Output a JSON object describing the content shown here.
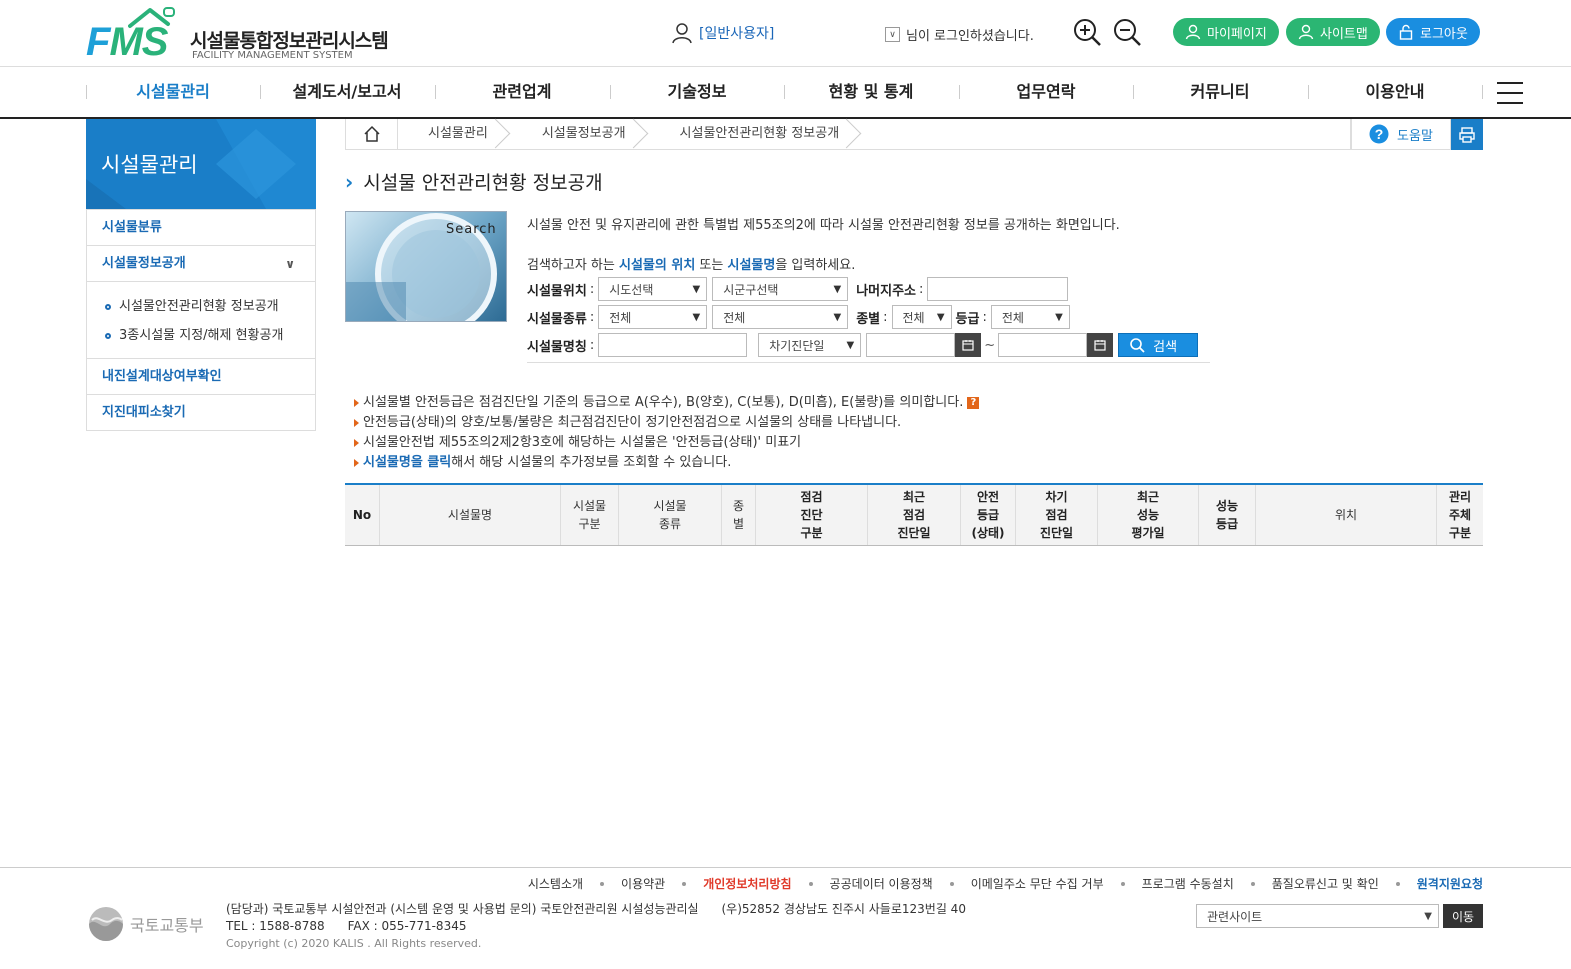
{
  "header": {
    "logo_mark": "FMS",
    "logo_title": "시설물통합정보관리시스템",
    "logo_subtitle": "FACILITY MANAGEMENT SYSTEM",
    "user_name": "[일반사용자]",
    "login_message": "님이 로그인하셨습니다.",
    "mypage_label": "마이페이지",
    "sitemap_label": "사이트맵",
    "logout_label": "로그아웃",
    "colors": {
      "green": "#2bb673",
      "blue": "#1a8ee0"
    }
  },
  "nav": {
    "items": [
      {
        "label": "시설물관리"
      },
      {
        "label": "설계도서/보고서"
      },
      {
        "label": "관련업계"
      },
      {
        "label": "기술정보"
      },
      {
        "label": "현황 및 통계"
      },
      {
        "label": "업무연락"
      },
      {
        "label": "커뮤니티"
      },
      {
        "label": "이용안내"
      }
    ],
    "active_color": "#1a7ec8"
  },
  "sidebar": {
    "title": "시설물관리",
    "items": [
      {
        "label": "시설물분류"
      },
      {
        "label": "시설물정보공개"
      },
      {
        "label": "내진설계대상여부확인"
      },
      {
        "label": "지진대피소찾기"
      }
    ],
    "sub_items": [
      {
        "label": "시설물안전관리현황 정보공개"
      },
      {
        "label": "3종시설물 지정/해제 현황공개"
      }
    ]
  },
  "breadcrumb": {
    "items": [
      "시설물관리",
      "시설물정보공개",
      "시설물안전관리현황 정보공개"
    ],
    "help_label": "도움말"
  },
  "page": {
    "title": "시설물 안전관리현황 정보공개",
    "image_word": "Search",
    "intro": "시설물 안전 및 유지관리에 관한 특별법 제55조의2에 따라 시설물 안전관리현황 정보를 공개하는 화면입니다.",
    "guide_prefix": "검색하고자 하는 ",
    "guide_hl1": "시설물의 위치",
    "guide_mid": " 또는 ",
    "guide_hl2": "시설물명",
    "guide_suffix": "을 입력하세요."
  },
  "form": {
    "location_label": "시설물위치",
    "sido_value": "시도선택",
    "sigungu_value": "시군구선택",
    "rest_addr_label": "나머지주소",
    "rest_addr_value": "",
    "type_label": "시설물종류",
    "type1_value": "전체",
    "type2_value": "전체",
    "class_label": "종별",
    "class_value": "전체",
    "grade_label": "등급",
    "grade_value": "전체",
    "name_label": "시설물명칭",
    "name_value": "",
    "date_type_value": "차기진단일",
    "date_from": "",
    "date_to": "",
    "tilde": "~",
    "search_label": "검색"
  },
  "notes": {
    "n1": "시설물별 안전등급은 점검진단일 기준의 등급으로 A(우수), B(양호), C(보통), D(미흡), E(불량)를 의미합니다.",
    "n1_icon": "?",
    "n2": "안전등급(상태)의 양호/보통/불량은 최근점검진단이 정기안전점검으로 시설물의 상태를 나타냅니다.",
    "n3": "시설물안전법 제55조의2제2항3호에 해당하는 시설물은 '안전등급(상태)' 미표기",
    "n4_hl": "시설물명을 클릭",
    "n4_rest": "해서 해당 시설물의 추가정보를 조회할 수 있습니다."
  },
  "table": {
    "columns": [
      {
        "key": "no",
        "label": "No"
      },
      {
        "key": "name",
        "label": "시설물명"
      },
      {
        "key": "div",
        "label": "시설물\n구분"
      },
      {
        "key": "kind",
        "label": "시설물\n종류"
      },
      {
        "key": "class",
        "label": "종\n별"
      },
      {
        "key": "insp",
        "label": "점검\n진단\n구분"
      },
      {
        "key": "recent",
        "label": "최근\n점검\n진단일"
      },
      {
        "key": "grade",
        "label": "안전\n등급\n(상태)"
      },
      {
        "key": "next",
        "label": "차기\n점검\n진단일"
      },
      {
        "key": "perf_date",
        "label": "최근\n성능\n평가일"
      },
      {
        "key": "perf_grade",
        "label": "성능\n등급"
      },
      {
        "key": "loc",
        "label": "위치"
      },
      {
        "key": "owner",
        "label": "관리\n주체\n구분"
      }
    ],
    "rows": []
  },
  "footer": {
    "links": [
      {
        "label": "시스템소개",
        "style": "normal"
      },
      {
        "label": "이용약관",
        "style": "normal"
      },
      {
        "label": "개인정보처리방침",
        "style": "red"
      },
      {
        "label": "공공데이터 이용정책",
        "style": "normal"
      },
      {
        "label": "이메일주소 무단 수집 거부",
        "style": "normal"
      },
      {
        "label": "프로그램 수동설치",
        "style": "normal"
      },
      {
        "label": "품질오류신고 및 확인",
        "style": "normal"
      },
      {
        "label": "원격지원요청",
        "style": "blue"
      }
    ],
    "ministry": "국토교통부",
    "contact_line": "(담당과) 국토교통부 시설안전과 (시스템 운영 및 사용법 문의) 국토안전관리원 시설성능관리실      (우)52852 경상남도 진주시 사들로123번길 40",
    "phone_line": "TEL : 1588-8788      FAX : 055-771-8345",
    "copyright": "Copyright (c) 2020 KALIS . All Rights reserved.",
    "related_site_value": "관련사이트",
    "go_label": "이동"
  }
}
